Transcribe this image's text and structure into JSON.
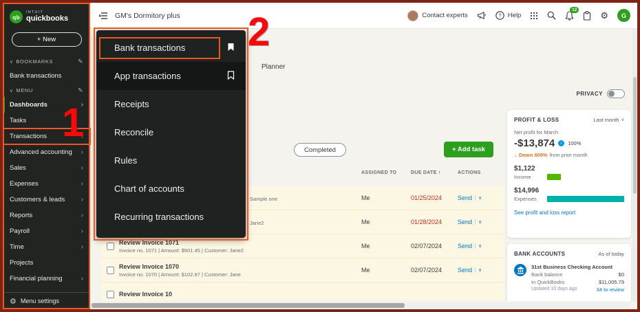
{
  "colors": {
    "qb_green": "#2ca01c",
    "link_teal": "#0077c5",
    "overdue_red": "#d52b1e",
    "income_bar": "#53b700",
    "expenses_bar": "#00b0aa",
    "trend_orange": "#e8731a",
    "annotation_orange": "#ee5722",
    "annotation_red": "#f40b0b"
  },
  "annotations": {
    "step1": "1",
    "step2": "2"
  },
  "sidebar": {
    "brand": {
      "logo": "qb",
      "intuit": "INTUIT",
      "product": "quickbooks"
    },
    "new_button": "+ New",
    "bookmarks_header": "BOOKMARKS",
    "bookmarks": [
      "Bank transactions"
    ],
    "menu_header": "MENU",
    "items": [
      "Dashboards",
      "Tasks",
      "Transactions",
      "Advanced accounting",
      "Sales",
      "Expenses",
      "Customers & leads",
      "Reports",
      "Payroll",
      "Time",
      "Projects",
      "Financial planning"
    ],
    "menu_settings": "Menu settings"
  },
  "header": {
    "company": "GM's Dormitory plus",
    "contact_experts": "Contact experts",
    "help": "Help",
    "notification_count": "12",
    "profile_initial": "G"
  },
  "flyout": {
    "items": [
      "Bank transactions",
      "App transactions",
      "Receipts",
      "Reconcile",
      "Rules",
      "Chart of accounts",
      "Recurring transactions"
    ]
  },
  "main": {
    "tab": "Planner",
    "privacy_label": "PRIVACY",
    "completed_chip": "Completed",
    "add_task": "+ Add task",
    "table": {
      "headers": [
        "ASSIGNED TO",
        "DUE DATE",
        "ACTIONS"
      ],
      "rows": [
        {
          "title": "",
          "subtitle": "Sample one",
          "assigned": "Me",
          "due": "01/25/2024",
          "action": "Send"
        },
        {
          "title": "",
          "subtitle": "Jane2",
          "assigned": "Me",
          "due": "01/28/2024",
          "action": "Send"
        },
        {
          "title": "Review Invoice 1071",
          "subtitle": "Invoice no. 1071 | Amount: $901.45 | Customer: Jane2",
          "assigned": "Me",
          "due": "02/07/2024",
          "action": "Send"
        },
        {
          "title": "Review Invoice 1070",
          "subtitle": "Invoice no. 1070 | Amount: $102.67 | Customer: Jane",
          "assigned": "Me",
          "due": "02/07/2024",
          "action": "Send"
        },
        {
          "title": "Review Invoice 10",
          "subtitle": "",
          "assigned": "",
          "due": "",
          "action": ""
        }
      ]
    }
  },
  "profit_loss": {
    "title": "PROFIT & LOSS",
    "period": "Last month",
    "subtitle": "Net profit for March",
    "net": "-$13,874",
    "percent": "100%",
    "trend": "Down 608%",
    "trend_suffix": "from prior month",
    "income_value": "$1,122",
    "income_label": "Income",
    "expenses_value": "$14,996",
    "expenses_label": "Expenses",
    "link": "See profit and loss report"
  },
  "bank_accounts": {
    "title": "BANK ACCOUNTS",
    "as_of": "As of today",
    "account": "31st Business Checking Account",
    "bank_balance_label": "Bank balance",
    "bank_balance": "$0",
    "in_qb_label": "In QuickBooks",
    "in_qb": "$11,005.79",
    "updated": "Updated 10 days ago",
    "review_link": "34 to review"
  }
}
